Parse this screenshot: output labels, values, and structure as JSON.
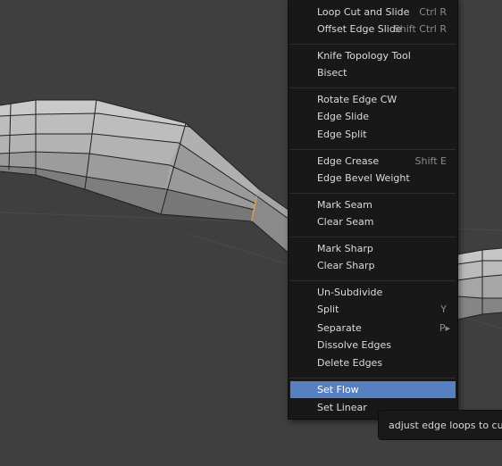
{
  "menu": {
    "items": [
      {
        "label": "Loop Cut and Slide",
        "shortcut": "Ctrl R"
      },
      {
        "label": "Offset Edge Slide",
        "shortcut": "Shift Ctrl R"
      },
      {
        "label": "Knife Topology Tool",
        "shortcut": ""
      },
      {
        "label": "Bisect",
        "shortcut": ""
      },
      {
        "label": "Rotate Edge CW",
        "shortcut": ""
      },
      {
        "label": "Edge Slide",
        "shortcut": ""
      },
      {
        "label": "Edge Split",
        "shortcut": ""
      },
      {
        "label": "Edge Crease",
        "shortcut": "Shift E"
      },
      {
        "label": "Edge Bevel Weight",
        "shortcut": ""
      },
      {
        "label": "Mark Seam",
        "shortcut": ""
      },
      {
        "label": "Clear Seam",
        "shortcut": ""
      },
      {
        "label": "Mark Sharp",
        "shortcut": ""
      },
      {
        "label": "Clear Sharp",
        "shortcut": ""
      },
      {
        "label": "Un-Subdivide",
        "shortcut": ""
      },
      {
        "label": "Split",
        "shortcut": "Y"
      },
      {
        "label": "Separate",
        "shortcut": "P▸"
      },
      {
        "label": "Dissolve Edges",
        "shortcut": ""
      },
      {
        "label": "Delete Edges",
        "shortcut": ""
      },
      {
        "label": "Set Flow",
        "shortcut": ""
      },
      {
        "label": "Set Linear",
        "shortcut": ""
      }
    ],
    "active_item": "Set Flow"
  },
  "tooltip": {
    "text": "adjust edge loops to curvature"
  },
  "colors": {
    "viewport_bg": "#3f3f3f",
    "menu_bg": "#181818",
    "highlight": "#5680c2",
    "selected_edge": "#e8a040"
  }
}
